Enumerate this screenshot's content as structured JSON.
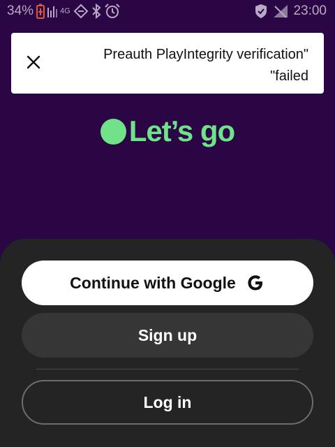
{
  "status_bar": {
    "battery_percent": "34%",
    "network": "4G",
    "time": "23:00",
    "icons": [
      "battery-charging-icon",
      "signal-icon",
      "data-saver-icon",
      "bluetooth-icon",
      "alarm-icon",
      "vpn-shield-icon",
      "wifi-off-icon"
    ]
  },
  "toast": {
    "message": "Preauth PlayIntegrity verification\"\n\"failed",
    "close_icon": "close-icon"
  },
  "logo": {
    "text": "Let’s go",
    "dot_color": "#6fe28a"
  },
  "actions": {
    "google_label": "Continue with Google",
    "google_icon": "google-g-icon",
    "signup_label": "Sign up",
    "login_label": "Log in"
  },
  "colors": {
    "background": "#2b0645",
    "accent": "#6fe28a",
    "sheet": "#242424"
  }
}
